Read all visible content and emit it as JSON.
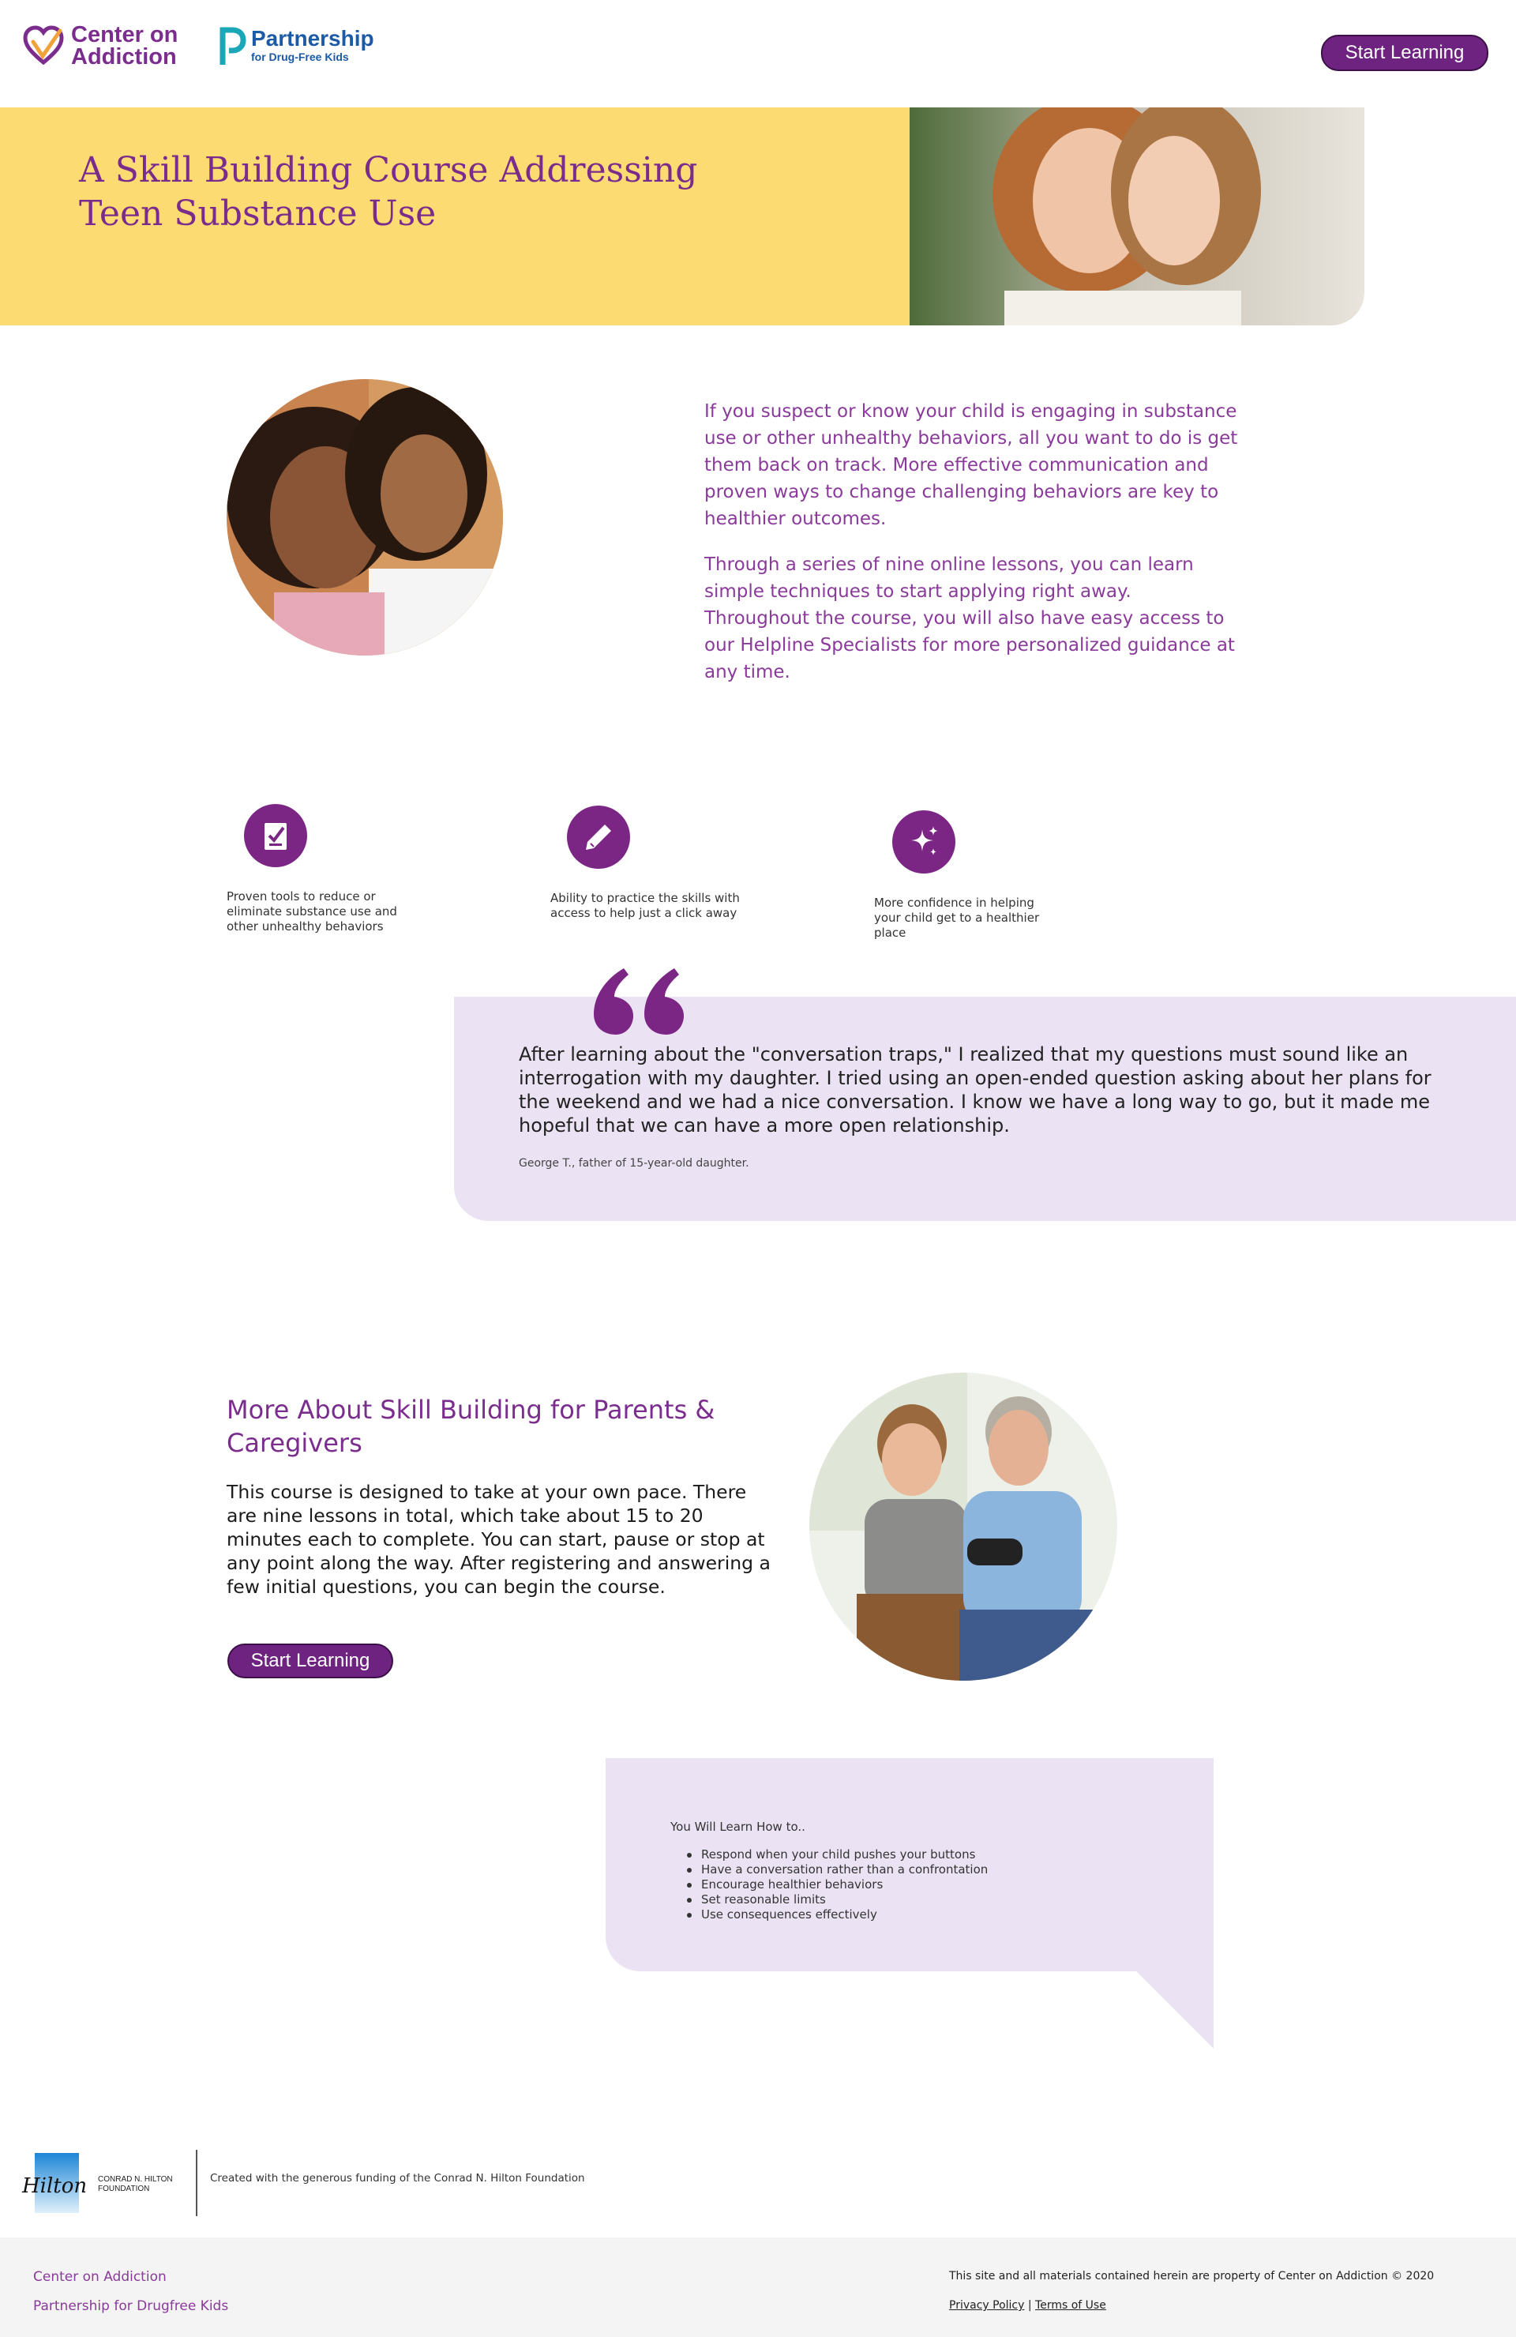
{
  "header": {
    "coa_logo_line1": "Center on",
    "coa_logo_line2": "Addiction",
    "pfk_logo_name": "Partnership",
    "pfk_logo_tagline": "for Drug-Free Kids",
    "start_button": "Start Learning"
  },
  "hero": {
    "title": "A Skill Building Course Addressing Teen Substance Use"
  },
  "intro": {
    "paragraph1": "If you suspect or know your child is engaging in substance use or other unhealthy behaviors, all you want to do is get them back on track. More effective communication and proven ways to change challenging behaviors are key to healthier outcomes.",
    "paragraph2": "Through a series of nine online lessons, you can learn simple techniques to start applying right away. Throughout the course, you will also have easy access to our Helpline Specialists for more personalized guidance at any time."
  },
  "features": [
    {
      "icon": "checklist-icon",
      "text": "Proven tools to reduce or eliminate substance use and other unhealthy behaviors"
    },
    {
      "icon": "pen-icon",
      "text": "Ability to practice the skills with access to help just a click away"
    },
    {
      "icon": "sparkle-icon",
      "text": "More confidence in helping your child get to a healthier place"
    }
  ],
  "quote": {
    "text": "After learning about the \"conversation traps,\" I realized that my questions must sound like an interrogation with my daughter. I tried using an open-ended question asking about her plans for the weekend and we had a nice conversation. I know we have a long way to go, but it made me hopeful that we can have a more open relationship.",
    "attribution": "George T., father of 15-year-old daughter."
  },
  "more": {
    "title": "More About Skill Building for Parents & Caregivers",
    "body": "This course is designed to take at your own pace. There are nine lessons in total, which take about 15 to 20 minutes each to complete. You can start, pause or stop at any point along the way. After registering and answering a few initial questions, you can begin the course.",
    "button": "Start Learning"
  },
  "learn": {
    "heading": "You Will Learn How to..",
    "items": [
      "Respond when your child pushes your buttons",
      "Have a conversation rather than a confrontation",
      "Encourage healthier behaviors",
      "Set reasonable limits",
      "Use consequences effectively"
    ]
  },
  "hilton": {
    "logo_line1": "CONRAD N. HILTON",
    "logo_line2": "FOUNDATION",
    "credit": "Created with the generous funding of the Conrad N. Hilton Foundation"
  },
  "footer": {
    "link1": "Center on Addiction",
    "link2": "Partnership for Drugfree Kids",
    "copyright": "This site and all materials contained herein are property of Center on Addiction © 2020",
    "privacy": "Privacy Policy",
    "separator": "|",
    "terms": "Terms of Use"
  },
  "colors": {
    "brand_purple": "#7b2d8e",
    "hero_yellow": "#fddb73",
    "lavender": "#ebe2f3",
    "pfk_blue": "#1c5aa6",
    "pfk_teal": "#1aa8b8"
  }
}
